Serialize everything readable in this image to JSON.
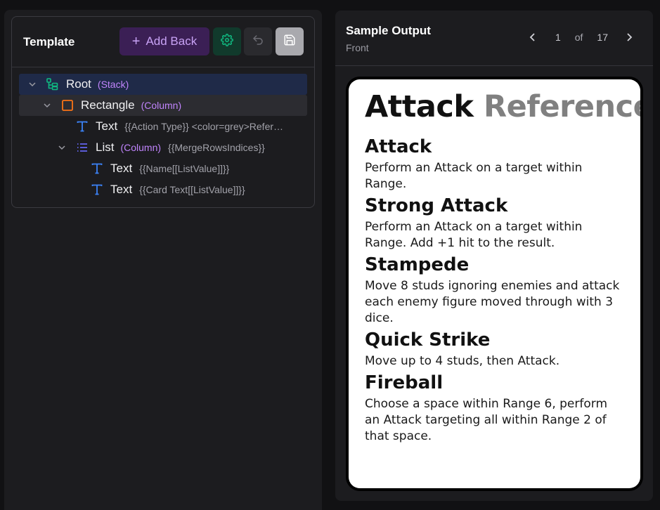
{
  "template": {
    "title": "Template",
    "add_back_label": "Add Back",
    "settings_icon": "gear-icon",
    "undo_icon": "undo-icon",
    "save_icon": "save-icon",
    "tree": [
      {
        "name": "Root",
        "type": "(Stack)",
        "expr": "",
        "icon": "stack-icon",
        "level": 0,
        "expanded": true
      },
      {
        "name": "Rectangle",
        "type": "(Column)",
        "expr": "",
        "icon": "rectangle-icon",
        "level": 1,
        "expanded": true
      },
      {
        "name": "Text",
        "type": "",
        "expr": "{{Action Type}} <color=grey>Refer…",
        "icon": "text-icon",
        "level": 2
      },
      {
        "name": "List",
        "type": "(Column)",
        "expr": "{{MergeRowsIndices}}",
        "icon": "list-icon",
        "level": 2,
        "expanded": true
      },
      {
        "name": "Text",
        "type": "",
        "expr": "{{Name[[ListValue]]}}",
        "icon": "text-icon",
        "level": 3
      },
      {
        "name": "Text",
        "type": "",
        "expr": "{{Card Text[[ListValue]]}}",
        "icon": "text-icon",
        "level": 3
      }
    ]
  },
  "output": {
    "title": "Sample Output",
    "subtitle": "Front",
    "page": "1",
    "of_label": "of",
    "total": "17",
    "card": {
      "title_main": "Attack",
      "title_accent": "Reference",
      "entries": [
        {
          "name": "Attack",
          "text": "Perform an Attack on a target within Range."
        },
        {
          "name": "Strong Attack",
          "text": "Perform an Attack on a target within Range. Add +1 hit to the result."
        },
        {
          "name": "Stampede",
          "text": "Move 8 studs ignoring enemies and attack each enemy figure moved through with 3 dice."
        },
        {
          "name": "Quick Strike",
          "text": "Move up to 4 studs, then Attack."
        },
        {
          "name": "Fireball",
          "text": "Choose a space within Range 6, perform an Attack targeting all within Range 2 of that space."
        }
      ]
    }
  },
  "colors": {
    "accent_purple": "#c084fc",
    "add_back_bg": "#3b1f55",
    "settings_green": "#10b981",
    "icon_blue": "#3b82f6",
    "icon_orange": "#f97316",
    "title_accent": "#808080"
  }
}
